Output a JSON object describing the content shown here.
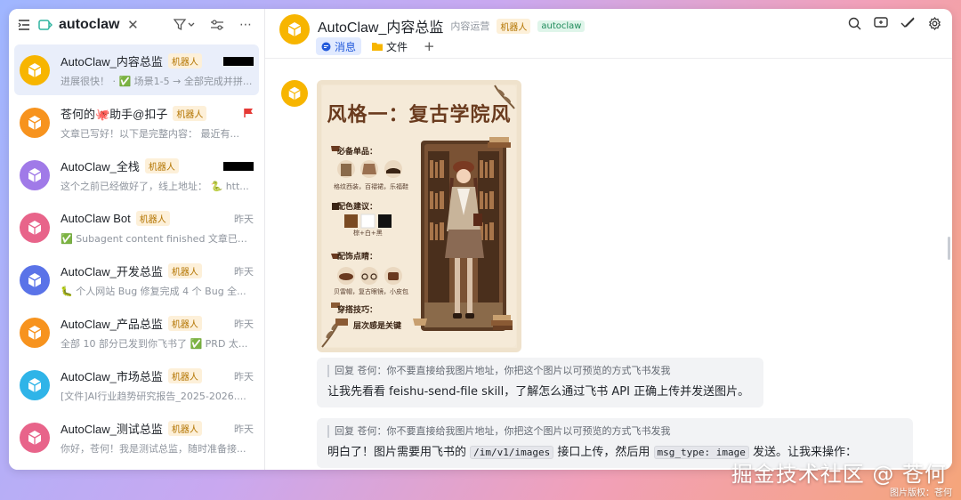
{
  "sidebar": {
    "title": "autoclaw",
    "conversations": [
      {
        "name": "AutoClaw_内容总监",
        "badge": "机器人",
        "time": "",
        "redacted": true,
        "preview": "进展很快！ · ✅ 场景1-5 → 全部完成并拼...",
        "color": "#f7b500",
        "active": true
      },
      {
        "name": "苍何的🐙助手@扣子",
        "badge": "机器人",
        "time": "",
        "flag": true,
        "preview": "文章已写好！以下是完整内容： 最近有...",
        "color": "#f7931e"
      },
      {
        "name": "AutoClaw_全栈",
        "badge": "机器人",
        "time": "",
        "redacted": true,
        "preview": "这个之前已经做好了，线上地址： 🐍 htt...",
        "color": "#a07ae8"
      },
      {
        "name": "AutoClaw Bot",
        "badge": "机器人",
        "time": "昨天",
        "preview": "✅ Subagent content finished 文章已完...",
        "color": "#e8648a"
      },
      {
        "name": "AutoClaw_开发总监",
        "badge": "机器人",
        "time": "昨天",
        "preview": "🐛 个人网站 Bug 修复完成 4 个 Bug 全...",
        "color": "#5a73e8"
      },
      {
        "name": "AutoClaw_产品总监",
        "badge": "机器人",
        "time": "昨天",
        "preview": "全部 10 部分已发到你飞书了 ✅ PRD 太...",
        "color": "#f7931e"
      },
      {
        "name": "AutoClaw_市场总监",
        "badge": "机器人",
        "time": "昨天",
        "preview": "[文件]AI行业趋势研究报告_2025-2026....",
        "color": "#2fb4e8"
      },
      {
        "name": "AutoClaw_测试总监",
        "badge": "机器人",
        "time": "昨天",
        "preview": "你好，苍何！我是测试总监，随时准备接...",
        "color": "#e8648a"
      }
    ]
  },
  "header": {
    "title": "AutoClaw_内容总监",
    "subtitle": "内容运营",
    "tag_bot": "机器人",
    "tag_claw": "autoclaw",
    "tab_messages": "消息",
    "tab_files": "文件",
    "tab_add": "+"
  },
  "poster": {
    "title": "风格一：复古学院风",
    "section_items": "必备单品：",
    "items_caption": "格纹西装，百褶裙，乐福鞋",
    "section_colors": "配色建议：",
    "colors_caption": "棕+白+黑",
    "section_accessories": "配饰点睛：",
    "accessories_caption": "贝雷帽，复古眼镜，小皮包",
    "section_tips": "穿搭技巧：",
    "tips_caption": "层次感是关键",
    "palette": [
      "#7a4a22",
      "#ffffff",
      "#111111"
    ]
  },
  "messages": [
    {
      "quote": "回复 苍何：你不要直接给我图片地址，你把这个图片以可预览的方式飞书发我",
      "text": "让我先看看 feishu-send-file skill，了解怎么通过飞书 API 正确上传并发送图片。"
    },
    {
      "quote": "回复 苍何：你不要直接给我图片地址，你把这个图片以可预览的方式飞书发我",
      "text_a": "明白了！图片需要用飞书的",
      "code_a": "/im/v1/images",
      "text_b": "接口上传，然后用",
      "code_b": "msg_type: image",
      "text_c": "发送。让我来操作："
    }
  ],
  "watermark": {
    "main": "掘金技术社区 @ 苍何",
    "sub": "图片版权：苍何"
  }
}
